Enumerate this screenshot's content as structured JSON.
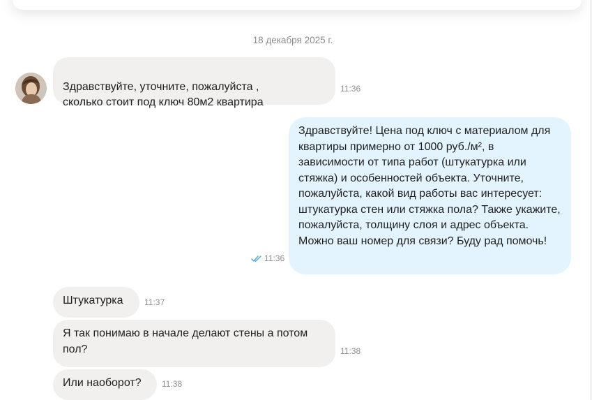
{
  "chat": {
    "date": "18 декабря 2025 г.",
    "messages": [
      {
        "text": "Здравствуйте, уточните, пожалуйста ,\nсколько стоит под ключ 80м2 квартира",
        "time": "11:36"
      },
      {
        "text": "Здравствуйте! Цена под ключ с материалом для квартиры примерно от 1000 руб./м², в зависимости от типа работ (штукатурка или стяжка) и особенностей объекта. Уточните, пожалуйста, какой вид работы вас интересует: штукатурка стен или стяжка пола? Также укажите, пожалуйста, толщину слоя и адрес объекта. Можно ваш номер для связи? Буду рад помочь!",
        "time": "11:36",
        "status": "read"
      },
      {
        "text": "Штукатурка",
        "time": "11:37"
      },
      {
        "text": "Я так понимаю в начале делают стены а потом пол?",
        "time": "11:38"
      },
      {
        "text": "Или наоборот?",
        "time": "11:38"
      }
    ]
  },
  "colors": {
    "incoming_bubble": "#f1f0ee",
    "outgoing_bubble": "#e4f4fe",
    "read_ticks": "#4aa8d8"
  }
}
